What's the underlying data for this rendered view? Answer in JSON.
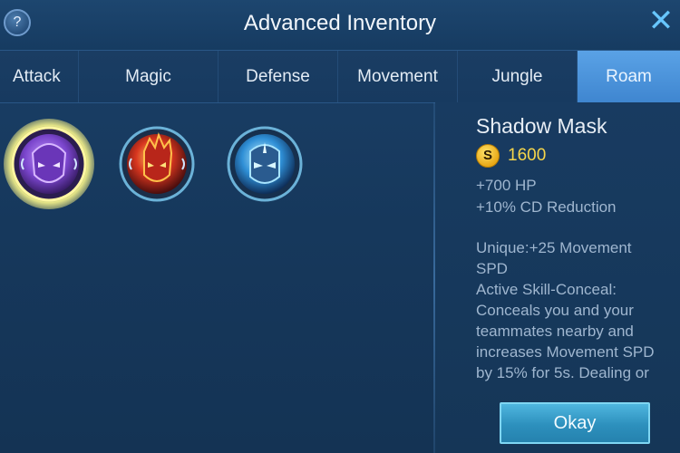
{
  "header": {
    "help_label": "?",
    "title": "Advanced Inventory",
    "close_label": "✕"
  },
  "tabs": [
    {
      "label": "Attack",
      "active": false
    },
    {
      "label": "Magic",
      "active": false
    },
    {
      "label": "Defense",
      "active": false
    },
    {
      "label": "Movement",
      "active": false
    },
    {
      "label": "Jungle",
      "active": false
    },
    {
      "label": "Roam",
      "active": true
    }
  ],
  "items": [
    {
      "icon": "shadow-mask-icon",
      "selected": true,
      "color": "#8a5cd6"
    },
    {
      "icon": "fire-mask-icon",
      "selected": false,
      "color": "#d6452a"
    },
    {
      "icon": "ice-mask-icon",
      "selected": false,
      "color": "#3aa0e0"
    }
  ],
  "details": {
    "name": "Shadow Mask",
    "gold_symbol": "S",
    "price": "1600",
    "stats": [
      "+700 HP",
      "+10% CD Reduction"
    ],
    "description": [
      "Unique:+25 Movement",
      "SPD",
      "Active Skill-Conceal:",
      "Conceals you and your",
      "teammates nearby and",
      "increases Movement SPD",
      "by 15% for 5s. Dealing or"
    ],
    "okay_label": "Okay"
  }
}
